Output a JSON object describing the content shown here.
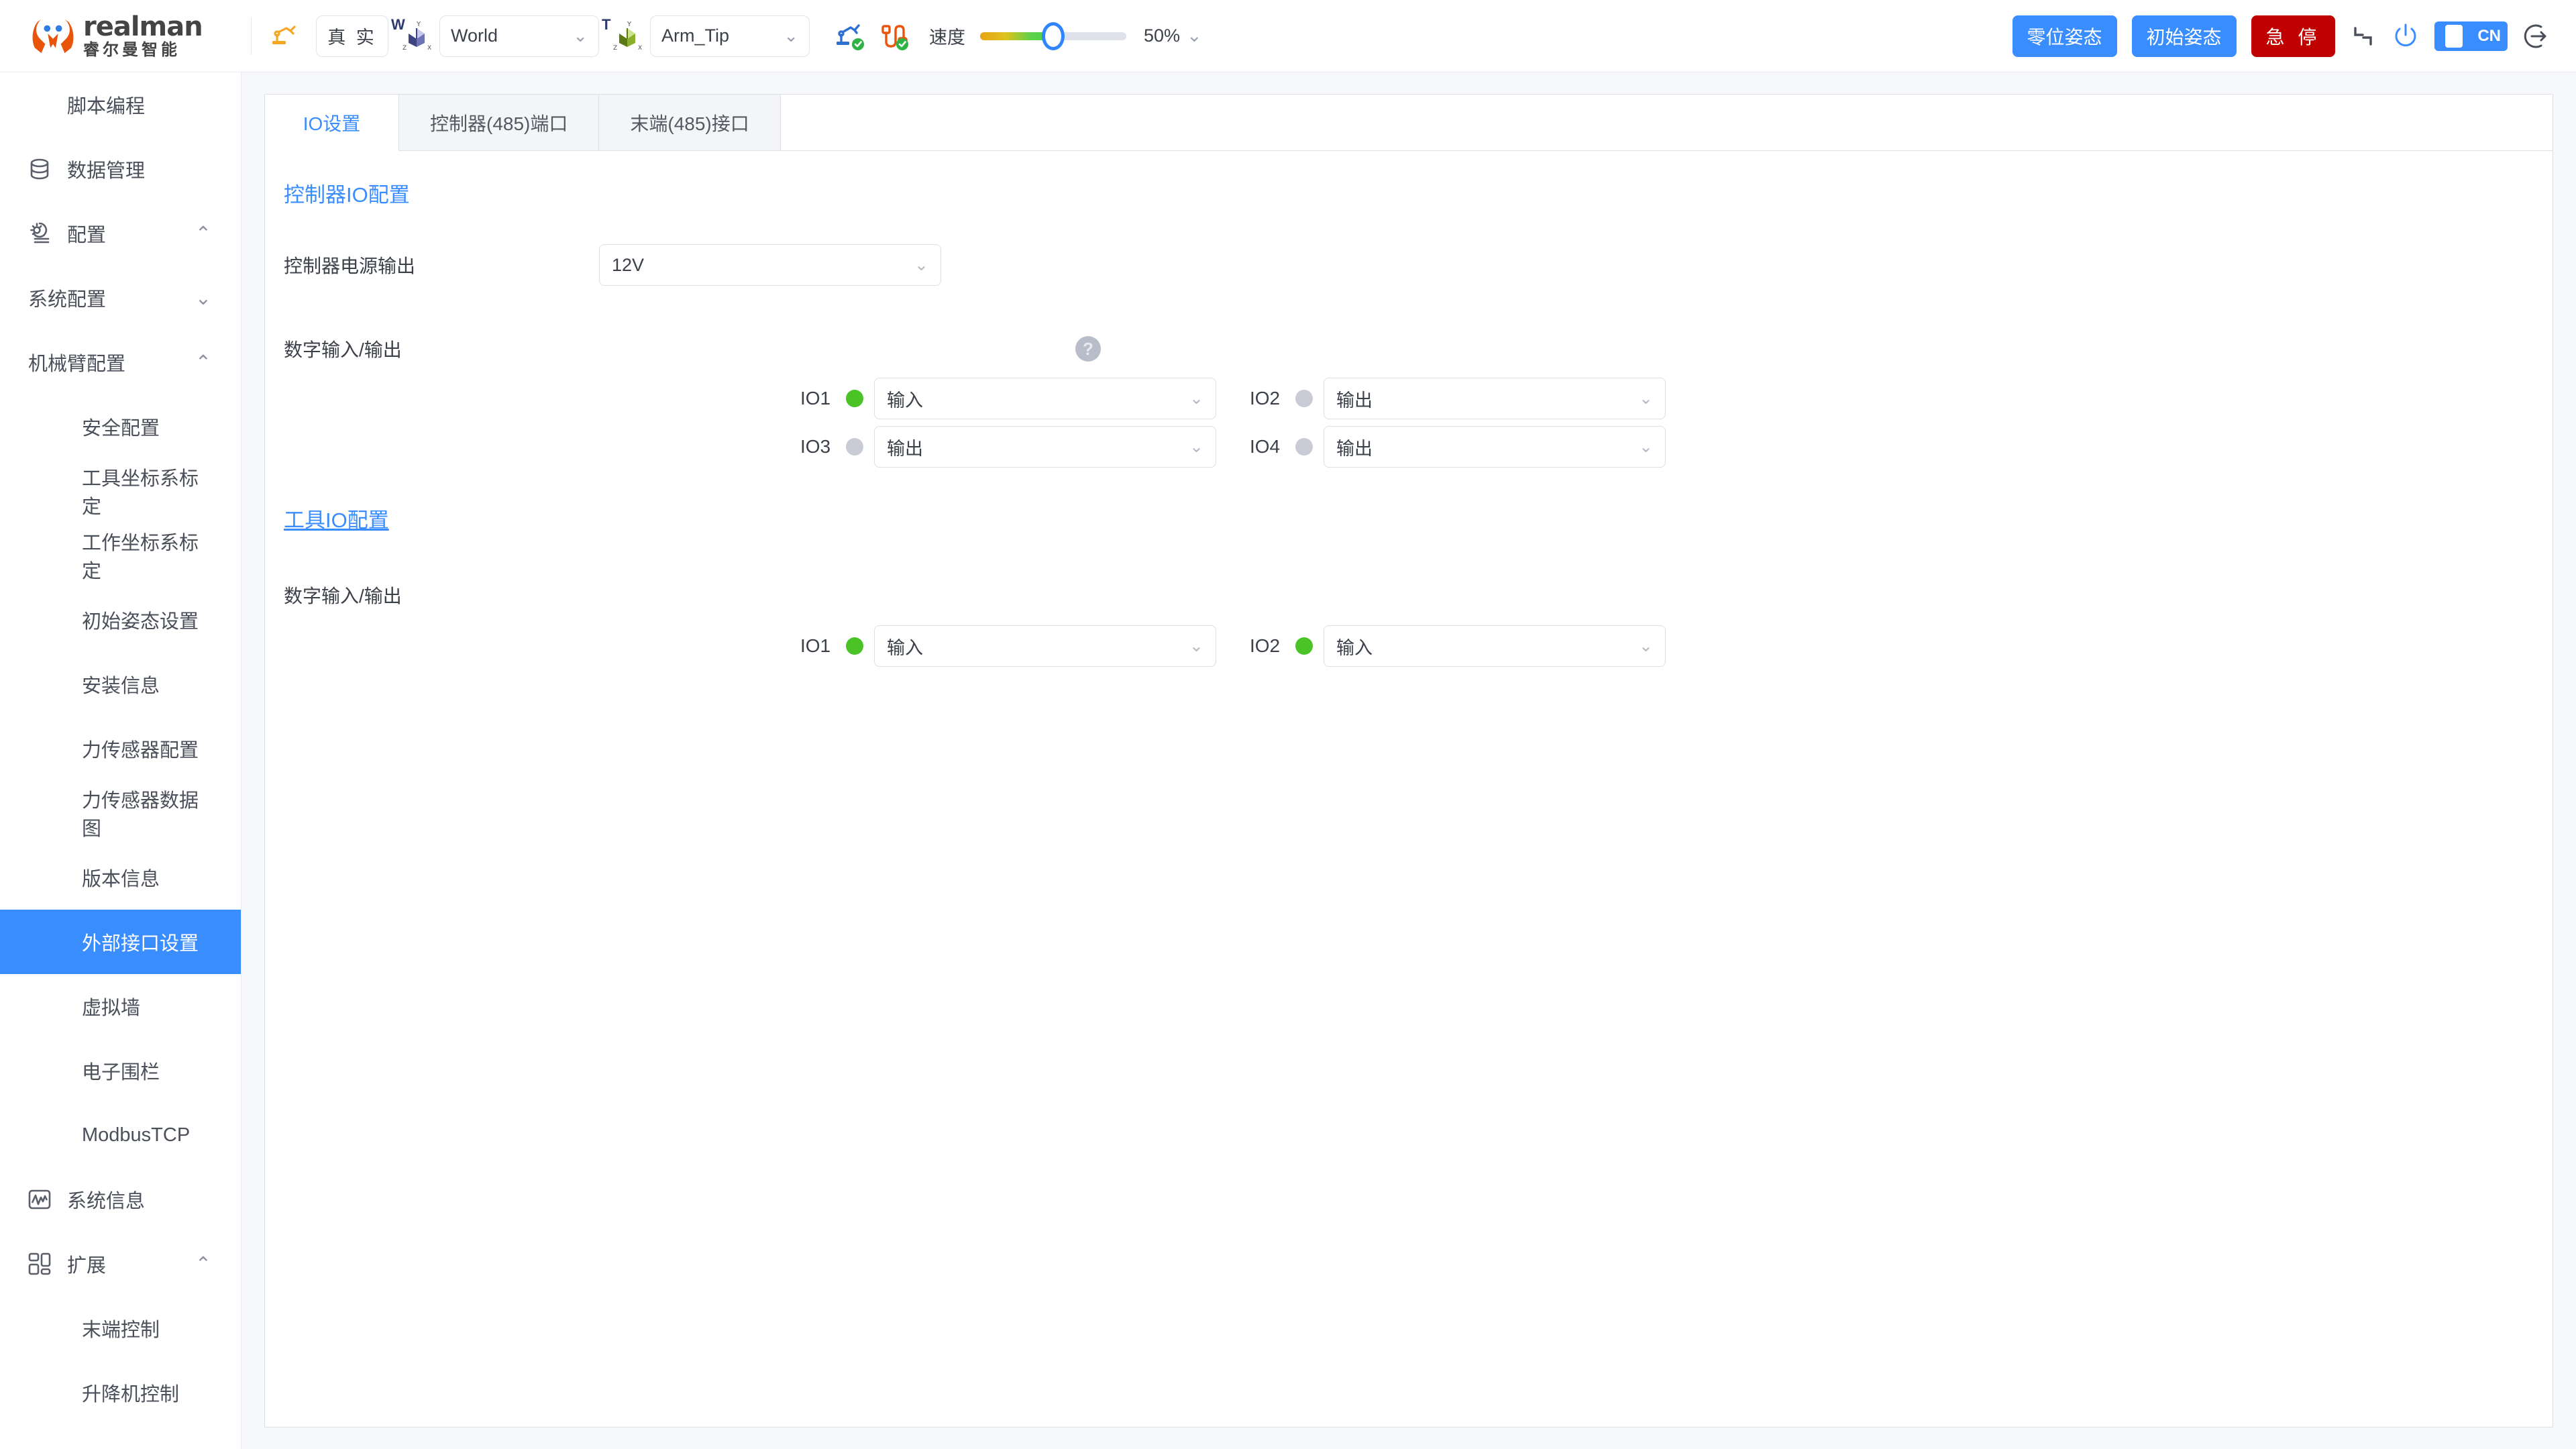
{
  "brand": {
    "name_en": "realman",
    "name_cn": "睿尔曼智能",
    "logo_icon": "realman-logo-icon"
  },
  "toolbar": {
    "robot_icon": "robot-arm-icon",
    "mode_label": "真 实",
    "world_frame": {
      "tag": "W",
      "value": "World",
      "axis_icon": "world-axis-icon",
      "chevron": "⌄"
    },
    "tool_frame": {
      "tag": "T",
      "value": "Arm_Tip",
      "axis_icon": "tool-axis-icon",
      "chevron": "⌄"
    },
    "status_arm_icon": "arm-connected-icon",
    "status_cable_icon": "cable-connected-icon",
    "speed_label": "速度",
    "speed_value": "50%",
    "speed_percent": 50,
    "speed_chevron": "⌄",
    "btn_zero_pose": "零位姿态",
    "btn_init_pose": "初始姿态",
    "btn_estop": "急 停",
    "collapse_icon": "collapse-corner-icon",
    "power_icon": "power-icon",
    "lang_label": "CN",
    "logout_icon": "logout-icon"
  },
  "sidebar": {
    "items": [
      {
        "label": "脚本编程",
        "level": 1,
        "icon": "",
        "chevron": "",
        "active": false
      },
      {
        "label": "数据管理",
        "level": 1,
        "icon": "database-icon",
        "chevron": "",
        "active": false
      },
      {
        "label": "配置",
        "level": 1,
        "icon": "gear-cloud-icon",
        "chevron": "⌃",
        "active": false
      },
      {
        "label": "系统配置",
        "level": 2,
        "icon": "",
        "chevron": "⌄",
        "active": false
      },
      {
        "label": "机械臂配置",
        "level": 2,
        "icon": "",
        "chevron": "⌃",
        "active": false
      },
      {
        "label": "安全配置",
        "level": 3,
        "icon": "",
        "chevron": "",
        "active": false
      },
      {
        "label": "工具坐标系标定",
        "level": 3,
        "icon": "",
        "chevron": "",
        "active": false
      },
      {
        "label": "工作坐标系标定",
        "level": 3,
        "icon": "",
        "chevron": "",
        "active": false
      },
      {
        "label": "初始姿态设置",
        "level": 3,
        "icon": "",
        "chevron": "",
        "active": false
      },
      {
        "label": "安装信息",
        "level": 3,
        "icon": "",
        "chevron": "",
        "active": false
      },
      {
        "label": "力传感器配置",
        "level": 3,
        "icon": "",
        "chevron": "",
        "active": false
      },
      {
        "label": "力传感器数据图",
        "level": 3,
        "icon": "",
        "chevron": "",
        "active": false
      },
      {
        "label": "版本信息",
        "level": 3,
        "icon": "",
        "chevron": "",
        "active": false
      },
      {
        "label": "外部接口设置",
        "level": 3,
        "icon": "",
        "chevron": "",
        "active": true
      },
      {
        "label": "虚拟墙",
        "level": 3,
        "icon": "",
        "chevron": "",
        "active": false
      },
      {
        "label": "电子围栏",
        "level": 3,
        "icon": "",
        "chevron": "",
        "active": false
      },
      {
        "label": "ModbusTCP",
        "level": 3,
        "icon": "",
        "chevron": "",
        "active": false
      },
      {
        "label": "系统信息",
        "level": 1,
        "icon": "wave-chart-icon",
        "chevron": "",
        "active": false
      },
      {
        "label": "扩展",
        "level": 1,
        "icon": "grid-blocks-icon",
        "chevron": "⌃",
        "active": false
      },
      {
        "label": "末端控制",
        "level": 3,
        "icon": "",
        "chevron": "",
        "active": false
      },
      {
        "label": "升降机控制",
        "level": 3,
        "icon": "",
        "chevron": "",
        "active": false
      }
    ]
  },
  "main": {
    "tabs": [
      {
        "label": "IO设置",
        "active": true
      },
      {
        "label": "控制器(485)端口",
        "active": false
      },
      {
        "label": "末端(485)接口",
        "active": false
      }
    ],
    "controller_section": {
      "title": "控制器IO配置",
      "power_output_label": "控制器电源输出",
      "power_output_value": "12V",
      "digital_io_label": "数字输入/输出",
      "help_icon": "question-help-icon",
      "io_rows": [
        {
          "name": "IO1",
          "state": "on",
          "value": "输入"
        },
        {
          "name": "IO2",
          "state": "off",
          "value": "输出"
        },
        {
          "name": "IO3",
          "state": "off",
          "value": "输出"
        },
        {
          "name": "IO4",
          "state": "off",
          "value": "输出"
        }
      ]
    },
    "tool_section": {
      "title": "工具IO配置",
      "digital_io_label": "数字输入/输出",
      "io_rows": [
        {
          "name": "IO1",
          "state": "on",
          "value": "输入"
        },
        {
          "name": "IO2",
          "state": "on",
          "value": "输入"
        }
      ]
    },
    "chevron": "⌄"
  },
  "colors": {
    "accent": "#3a8dff",
    "danger": "#c00000",
    "on": "#49c326",
    "off": "#c9ccd6",
    "bg": "#f7f8fc"
  }
}
